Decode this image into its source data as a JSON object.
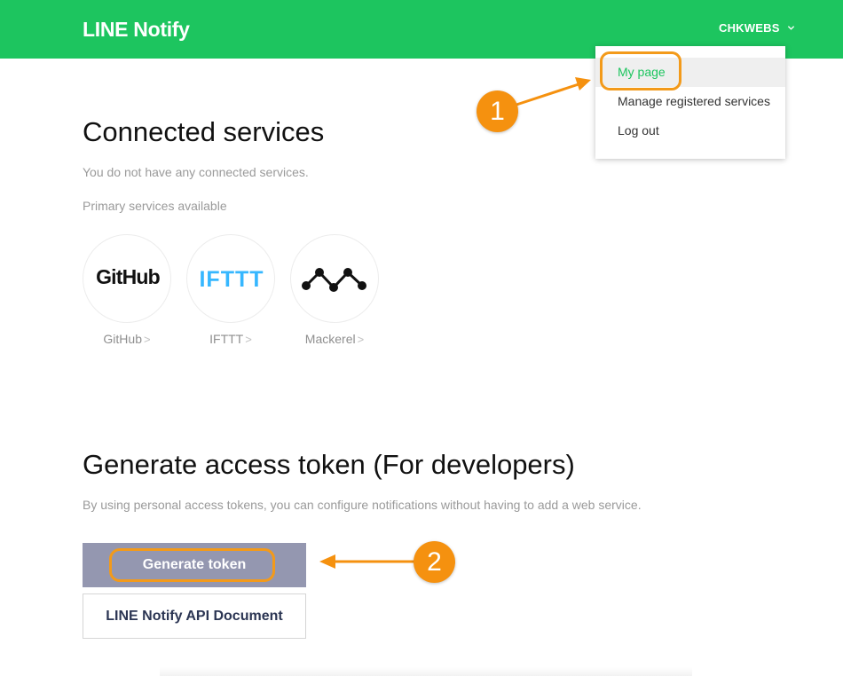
{
  "header": {
    "logo": "LINE Notify",
    "user_name": "CHKWEBS",
    "brand_color": "#1dc55f"
  },
  "dropdown": {
    "items": [
      {
        "label": "My page",
        "active": true
      },
      {
        "label": "Manage registered services",
        "active": false
      },
      {
        "label": "Log out",
        "active": false
      }
    ]
  },
  "connected": {
    "title": "Connected services",
    "empty_message": "You do not have any connected services.",
    "primary_label": "Primary services available",
    "services": [
      {
        "name": "GitHub",
        "logo_text": "GitHub",
        "arrow": ">"
      },
      {
        "name": "IFTTT",
        "logo_text": "IFTTT",
        "arrow": ">"
      },
      {
        "name": "Mackerel",
        "logo_icon": "mackerel-icon",
        "arrow": ">"
      }
    ]
  },
  "generate": {
    "title": "Generate access token (For developers)",
    "description": "By using personal access tokens, you can configure notifications without having to add a web service.",
    "generate_button": "Generate token",
    "doc_button": "LINE Notify API Document"
  },
  "annotations": {
    "step1": "1",
    "step2": "2",
    "accent_color": "#f5910f"
  }
}
